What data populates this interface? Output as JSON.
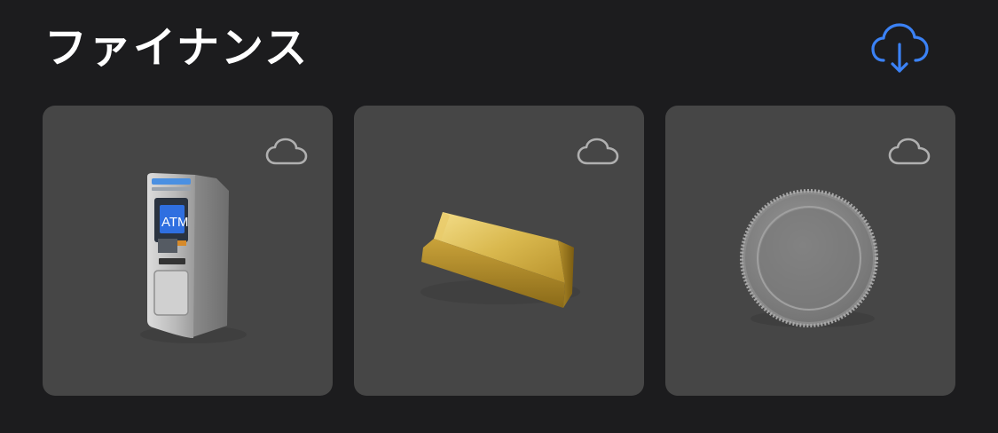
{
  "section": {
    "title": "ファイナンス",
    "download_icon": "cloud-download-icon",
    "accent_color": "#3b82f6"
  },
  "items": [
    {
      "name": "atm",
      "icon": "atm-machine",
      "status_icon": "cloud-icon"
    },
    {
      "name": "gold-bar",
      "icon": "gold-bar",
      "status_icon": "cloud-icon"
    },
    {
      "name": "silver-coin",
      "icon": "silver-coin",
      "status_icon": "cloud-icon"
    }
  ],
  "atm_screen_text": "ATM"
}
